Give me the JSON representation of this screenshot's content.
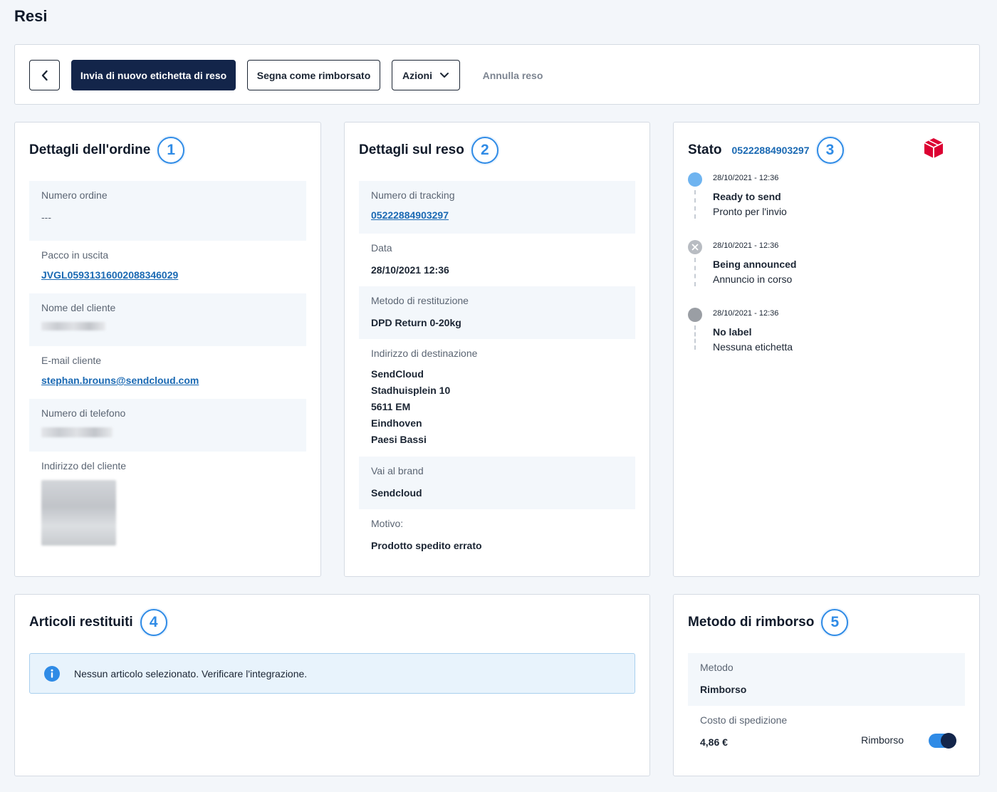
{
  "page": {
    "title": "Resi"
  },
  "toolbar": {
    "back_icon": "chevron-left-icon",
    "resend_label": "Invia di nuovo etichetta di reso",
    "refunded_label": "Segna come rimborsato",
    "actions_label": "Azioni",
    "cancel_label": "Annulla reso"
  },
  "order": {
    "title": "Dettagli dell'ordine",
    "badge": "1",
    "order_number_label": "Numero ordine",
    "order_number_value": "---",
    "outgoing_label": "Pacco in uscita",
    "outgoing_value": "JVGL05931316002088346029",
    "customer_name_label": "Nome del cliente",
    "customer_email_label": "E-mail cliente",
    "customer_email_value": "stephan.brouns@sendcloud.com",
    "phone_label": "Numero di telefono",
    "address_label": "Indirizzo del cliente"
  },
  "return": {
    "title": "Dettagli sul reso",
    "badge": "2",
    "tracking_label": "Numero di tracking",
    "tracking_value": "05222884903297",
    "date_label": "Data",
    "date_value": "28/10/2021 12:36",
    "method_label": "Metodo di restituzione",
    "method_value": "DPD Return 0-20kg",
    "destination_label": "Indirizzo di destinazione",
    "destination_lines": [
      "SendCloud",
      "Stadhuisplein 10",
      "5611 EM",
      "Eindhoven",
      "Paesi Bassi"
    ],
    "brand_label": "Vai al brand",
    "brand_value": "Sendcloud",
    "reason_label": "Motivo:",
    "reason_value": "Prodotto spedito errato"
  },
  "status": {
    "title": "Stato",
    "tracking": "05222884903297",
    "badge": "3",
    "carrier_icon": "dpd-logo-icon",
    "events": [
      {
        "date": "28/10/2021 - 12:36",
        "title": "Ready to send",
        "subtitle": "Pronto per l'invio",
        "color": "#6fb4f0"
      },
      {
        "date": "28/10/2021 - 12:36",
        "title": "Being announced",
        "subtitle": "Annuncio in corso",
        "color": "#b8bcc2"
      },
      {
        "date": "28/10/2021 - 12:36",
        "title": "No label",
        "subtitle": "Nessuna etichetta",
        "color": "#9a9ea4"
      }
    ]
  },
  "items": {
    "title": "Articoli restituiti",
    "badge": "4",
    "info_icon": "info-icon",
    "empty_message": "Nessun articolo selezionato. Verificare l'integrazione."
  },
  "refund": {
    "title": "Metodo di rimborso",
    "badge": "5",
    "method_label": "Metodo",
    "method_value": "Rimborso",
    "shipping_cost_label": "Costo di spedizione",
    "shipping_cost_value": "4,86 €",
    "toggle_label": "Rimborso",
    "toggle_on": true
  },
  "colors": {
    "primary": "#13254a",
    "accent": "#2f8be6",
    "link": "#1a69b3",
    "dpd_red": "#dc0032"
  }
}
